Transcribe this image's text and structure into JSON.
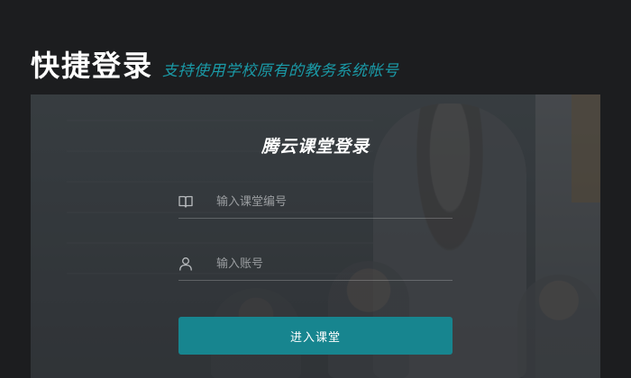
{
  "header": {
    "title": "快捷登录",
    "subtitle": "支持使用学校原有的教务系统帐号"
  },
  "login": {
    "title": "腾云课堂登录",
    "classroom_field": {
      "icon": "book-icon",
      "placeholder": "输入课堂编号",
      "value": ""
    },
    "account_field": {
      "icon": "user-icon",
      "placeholder": "输入账号",
      "value": ""
    },
    "submit_label": "进入课堂"
  },
  "colors": {
    "accent": "#17858f",
    "subtitle": "#1a9aa7",
    "background": "#1c1d1f"
  }
}
